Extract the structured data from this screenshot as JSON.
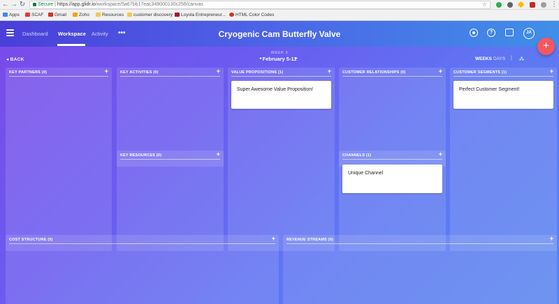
{
  "browser": {
    "url_secure": "Secure",
    "url_host": "https://app.glidr.io",
    "url_path": "/workspace/5a67bb17eac349000130c256/canvas",
    "bookmarks": [
      {
        "label": "Apps",
        "color": "#4285f4"
      },
      {
        "label": "SCAF",
        "color": "#e53935"
      },
      {
        "label": "Gmail",
        "color": "#d93025"
      },
      {
        "label": "Zoho",
        "color": "#f4a300"
      },
      {
        "label": "Resources",
        "color": "#f2c94c"
      },
      {
        "label": "customer discovery",
        "color": "#f2c94c"
      },
      {
        "label": "Loyola Entrepreneur...",
        "color": "#a31d2a"
      },
      {
        "label": "HTML Color Codes",
        "color": "#d93025"
      }
    ]
  },
  "app": {
    "title": "Cryogenic Cam Butterfly Valve",
    "tabs": [
      {
        "label": "Dashboard",
        "active": false
      },
      {
        "label": "Workspace",
        "active": true
      },
      {
        "label": "Activity",
        "active": false
      }
    ],
    "more": "•••",
    "avatar_initials": "JA",
    "fab": "+",
    "help_icon_text": "?"
  },
  "toolbar": {
    "back": "◂ BACK",
    "week": "WEEK 3",
    "range": "February 5-11",
    "prev": "◂",
    "next": "▸",
    "weeks": "WEEKS",
    "days": "DAYS",
    "separator": "|",
    "tree": "⁂"
  },
  "canvas": {
    "key_partners": {
      "title": "KEY PARTNERS (0)",
      "add": "+"
    },
    "key_activities": {
      "title": "KEY ACTIVITIES (0)",
      "add": "+"
    },
    "key_resources": {
      "title": "KEY RESOURCES (0)",
      "add": "+"
    },
    "value_propositions": {
      "title": "VALUE PROPOSITIONS (1)",
      "add": "+",
      "card": "Super Awesome Value Proposition!"
    },
    "customer_relationships": {
      "title": "CUSTOMER RELATIONSHIPS (0)",
      "add": "+"
    },
    "channels": {
      "title": "CHANNELS (1)",
      "add": "+",
      "card": "Unique Channel"
    },
    "customer_segments": {
      "title": "CUSTOMER SEGMENTS (1)",
      "add": "+",
      "card": "Perfect Customer Segment!"
    },
    "cost_structure": {
      "title": "COST STRUCTURE (0)",
      "add": "+"
    },
    "revenue_streams": {
      "title": "REVENUE STREAMS (0)",
      "add": "+"
    }
  }
}
